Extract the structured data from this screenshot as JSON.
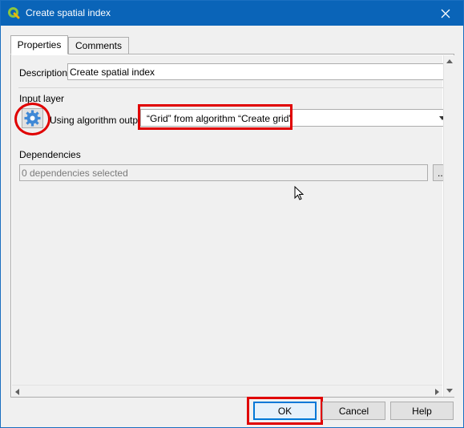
{
  "window": {
    "title": "Create spatial index",
    "app_icon": "qgis-icon",
    "close_icon": "close-icon"
  },
  "tabs": [
    {
      "label": "Properties",
      "active": true
    },
    {
      "label": "Comments",
      "active": false
    }
  ],
  "form": {
    "description_label": "Description",
    "description_value": "Create spatial index",
    "input_layer_label": "Input layer",
    "source_mode_label": "Using algorithm output",
    "source_value": "“Grid” from algorithm “Create grid”",
    "dependencies_label": "Dependencies",
    "dependencies_value": "0 dependencies selected",
    "browse_label": "..."
  },
  "buttons": {
    "ok": "OK",
    "cancel": "Cancel",
    "help": "Help"
  },
  "colors": {
    "titlebar": "#0a64b8",
    "highlight": "#e00000",
    "gear_blue": "#3f88d6"
  }
}
